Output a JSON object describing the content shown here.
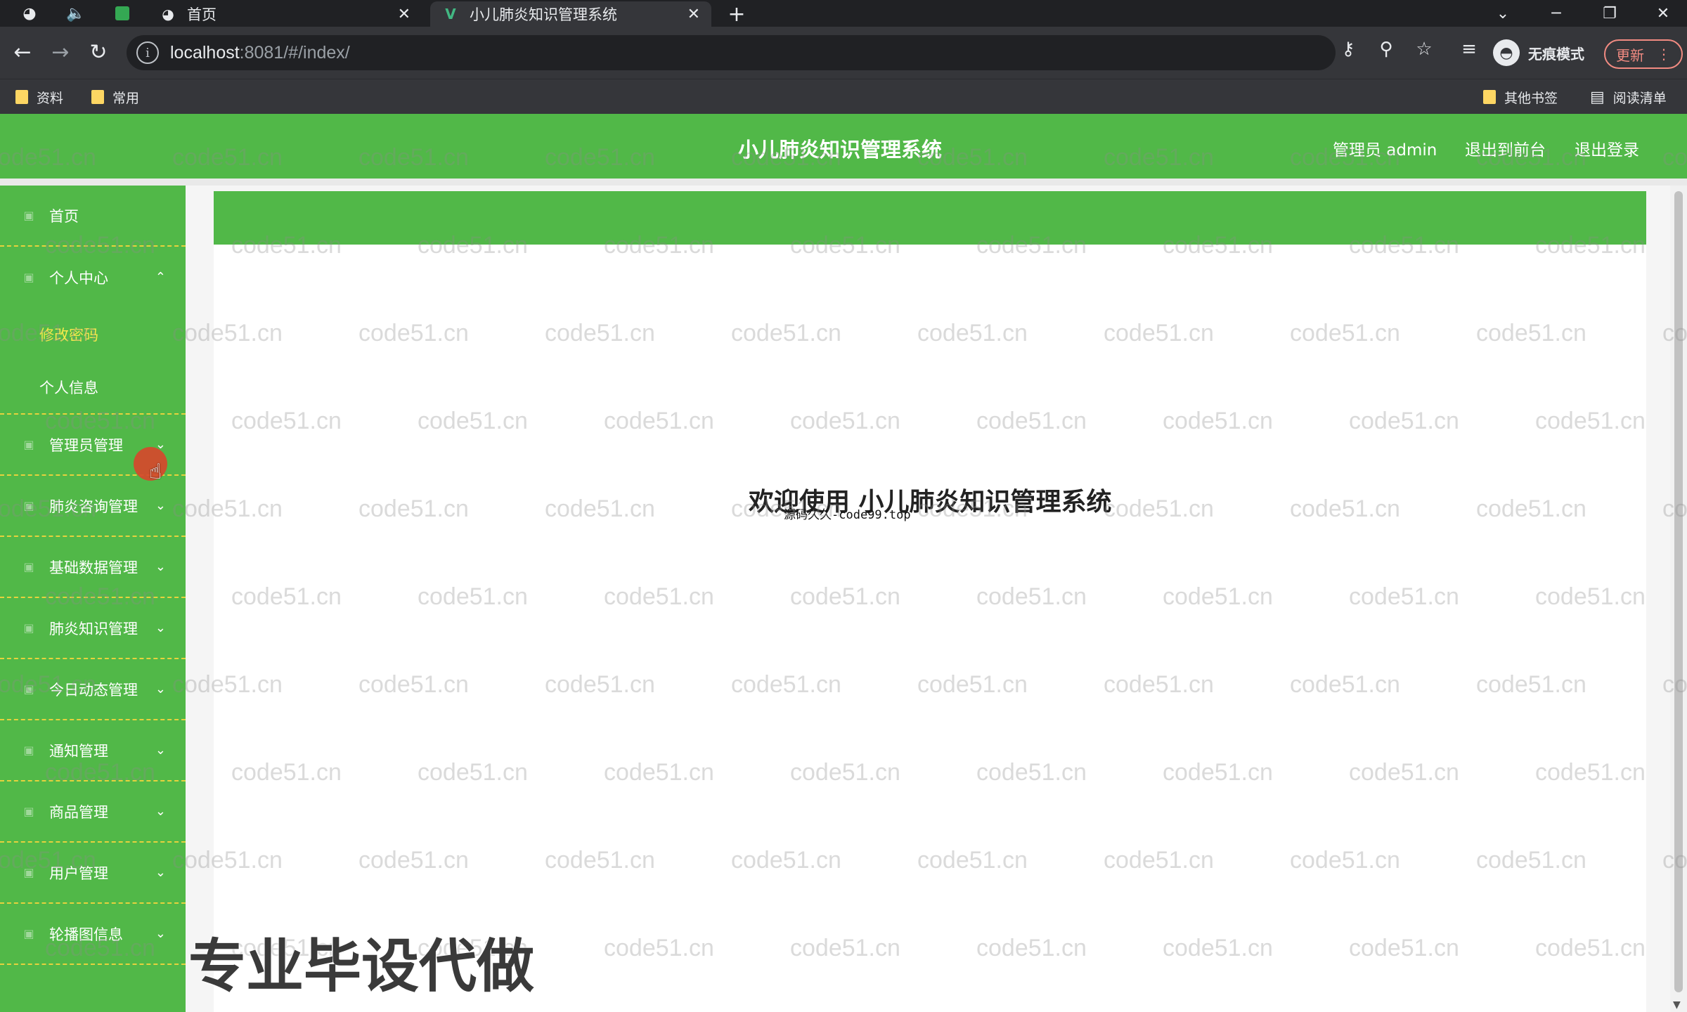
{
  "browser": {
    "tabs": [
      {
        "title": "首页",
        "close": "✕"
      },
      {
        "title": "小儿肺炎知识管理系统",
        "close": "✕"
      }
    ],
    "new_tab": "+",
    "url_host": "localhost",
    "url_rest": ":8081/#/index/",
    "profile_label": "无痕模式",
    "update_label": "更新",
    "bookmarks": [
      "资料",
      "常用"
    ],
    "other_bookmarks": "其他书签",
    "reading_list": "阅读清单"
  },
  "app": {
    "title": "小儿肺炎知识管理系统",
    "user_label": "管理员 admin",
    "back_to_front": "退出到前台",
    "logout": "退出登录",
    "accent_color": "#51b848"
  },
  "sidebar": {
    "items": [
      {
        "label": "首页",
        "arrow": ""
      },
      {
        "label": "个人中心",
        "arrow": "⌃"
      },
      {
        "label": "管理员管理",
        "arrow": "⌄"
      },
      {
        "label": "肺炎咨询管理",
        "arrow": "⌄"
      },
      {
        "label": "基础数据管理",
        "arrow": "⌄"
      },
      {
        "label": "肺炎知识管理",
        "arrow": "⌄"
      },
      {
        "label": "今日动态管理",
        "arrow": "⌄"
      },
      {
        "label": "通知管理",
        "arrow": "⌄"
      },
      {
        "label": "商品管理",
        "arrow": "⌄"
      },
      {
        "label": "用户管理",
        "arrow": "⌄"
      },
      {
        "label": "轮播图信息",
        "arrow": "⌄"
      }
    ],
    "sub_items": [
      "修改密码",
      "个人信息"
    ]
  },
  "main": {
    "welcome": "欢迎使用 小儿肺炎知识管理系统",
    "caption": "源码久久-code99.top"
  },
  "overlay": {
    "promo": "专业毕设代做",
    "watermark_text": "code51.cn"
  }
}
